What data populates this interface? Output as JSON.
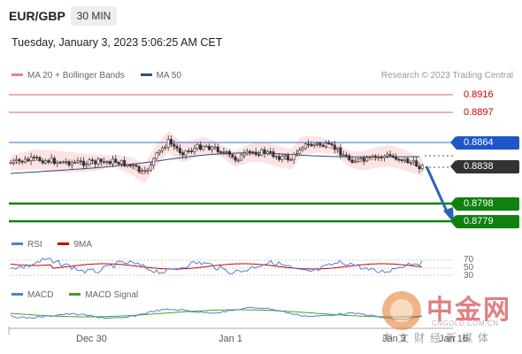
{
  "header": {
    "symbol": "EUR/GBP",
    "timeframe": "30 MIN",
    "datetime": "Tuesday, January 3, 2023 5:06:25 AM CET"
  },
  "legend": {
    "items": [
      {
        "label": "MA 20 + Bollinger Bands",
        "color": "#f08080"
      },
      {
        "label": "MA 50",
        "color": "#2c4f86"
      }
    ],
    "copyright": "Research © 2023 Trading Central"
  },
  "levels": {
    "r2": "0.8916",
    "r1": "0.8897",
    "pivot": "0.8864",
    "last": "0.8838",
    "s1": "0.8798",
    "s2": "0.8779"
  },
  "rsi": {
    "legend": [
      {
        "label": "RSI",
        "color": "#4f7fd8"
      },
      {
        "label": "9MA",
        "color": "#cc0000"
      }
    ],
    "levels": [
      "70",
      "50",
      "30"
    ]
  },
  "macd": {
    "legend": [
      {
        "label": "MACD",
        "color": "#4f7fd8"
      },
      {
        "label": "MACD Signal",
        "color": "#44a020"
      }
    ]
  },
  "xaxis": [
    "Dec 30",
    "Jan 1",
    "Jan 3",
    "Jan 16"
  ],
  "colors": {
    "resistance": "#cc0000",
    "pivot": "#1e56c8",
    "support": "#10800e",
    "bullish": "#ffffff",
    "bearish": "#333333",
    "bollinger": "#fde3e3",
    "forecast_arrow": "#2a64b0"
  },
  "watermark": {
    "brand_cn": "中金网",
    "url": "CNGOLD.COM.CN",
    "tagline": "中文财经新媒体"
  }
}
